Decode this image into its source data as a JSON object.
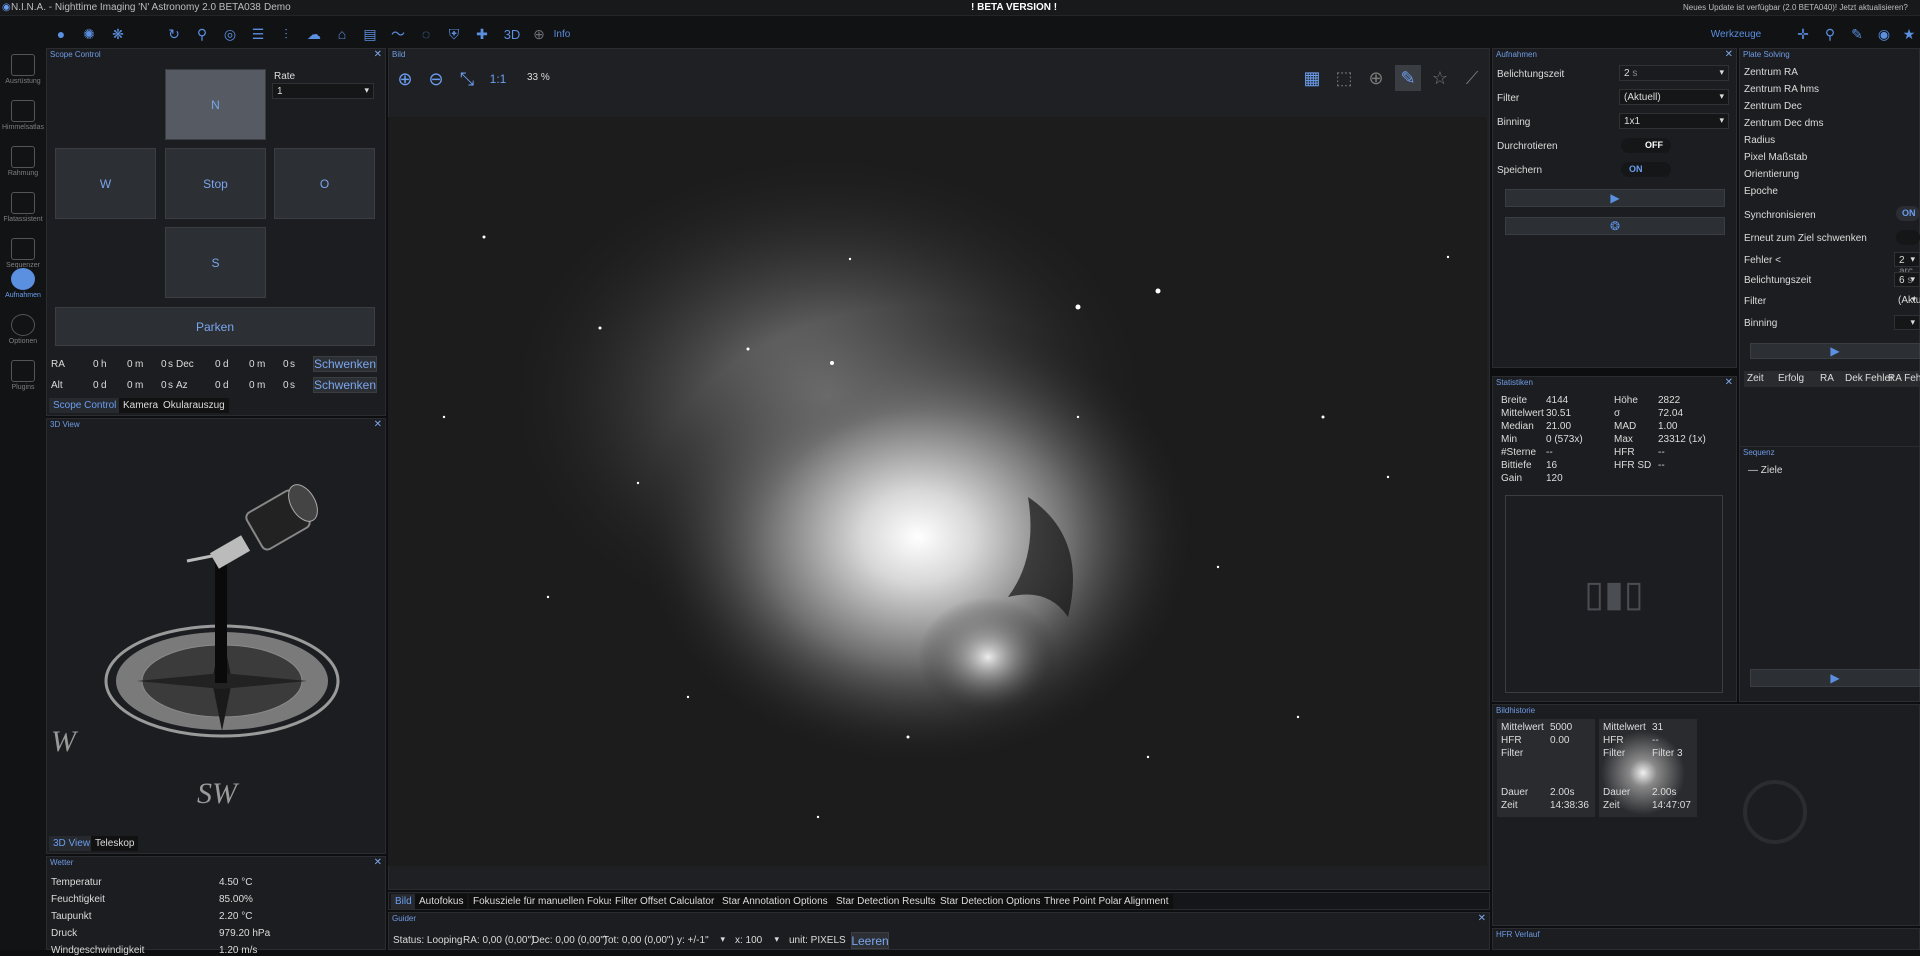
{
  "titlebar": {
    "app_title": "N.I.N.A. - Nighttime Imaging 'N' Astronomy 2.0 BETA038",
    "profile": "Demo",
    "beta_notice": "! BETA VERSION !",
    "update_notice": "Neues Update ist verfügbar (2.0 BETA040)! Jetzt aktualisieren?"
  },
  "toolbar": {
    "btn_3d": "3D",
    "btn_info": "Info",
    "tools_label": "Werkzeuge",
    "icons": [
      "camera-icon",
      "filter-wheel-icon",
      "focuser-icon",
      "rotator-icon",
      "telescope-icon",
      "guider-icon",
      "weather-icon",
      "dome-icon",
      "flat-panel-icon",
      "switch-icon",
      "guide-graph-icon",
      "bulb-icon",
      "safety-icon",
      "plugin-icon"
    ]
  },
  "sidebar": {
    "items": [
      {
        "label": "Ausrüstung",
        "icon": "equipment-icon"
      },
      {
        "label": "Himmelsatlas",
        "icon": "sky-atlas-icon"
      },
      {
        "label": "Rahmung",
        "icon": "framing-icon"
      },
      {
        "label": "Flatassistent",
        "icon": "flat-wizard-icon"
      },
      {
        "label": "Sequenzer",
        "icon": "sequencer-icon"
      },
      {
        "label": "Aufnahmen",
        "icon": "imaging-icon"
      },
      {
        "label": "Optionen",
        "icon": "options-icon"
      },
      {
        "label": "Plugins",
        "icon": "plugins-icon"
      }
    ]
  },
  "scope": {
    "title": "Scope Control",
    "rate_label": "Rate",
    "rate_value": "1",
    "north": "N",
    "west": "W",
    "stop": "Stop",
    "east": "O",
    "south": "S",
    "park": "Parken",
    "ra_label": "RA",
    "dec_label": "Dec",
    "alt_label": "Alt",
    "az_label": "Az",
    "ra_h": "0",
    "h": "h",
    "ra_m": "0",
    "m": "m",
    "ra_s": "0",
    "s": "s",
    "dec_d": "0",
    "d": "d",
    "dec_m": "0",
    "dec_s": "0",
    "alt_d": "0",
    "alt_m": "0",
    "alt_s": "0",
    "az_d": "0",
    "az_m": "0",
    "az_s": "0",
    "slew": "Schwenken",
    "tabs": [
      "Scope Control",
      "Kamera",
      "Okularauszug"
    ]
  },
  "view3d": {
    "title": "3D View",
    "compass_w": "W",
    "compass_sw": "SW",
    "tabs": [
      "3D View",
      "Teleskop"
    ]
  },
  "weather": {
    "title": "Wetter",
    "rows": [
      {
        "label": "Temperatur",
        "value": "4.50 °C"
      },
      {
        "label": "Feuchtigkeit",
        "value": "85.00%"
      },
      {
        "label": "Taupunkt",
        "value": "2.20 °C"
      },
      {
        "label": "Druck",
        "value": "979.20 hPa"
      },
      {
        "label": "Windgeschwindigkeit",
        "value": "1.20 m/s"
      }
    ]
  },
  "image": {
    "title": "Bild",
    "zoom_label": "1:1",
    "zoom_percent": "33 %"
  },
  "bottom_tabs": [
    "Bild",
    "Autofokus",
    "Fokusziele für manuellen Fokus",
    "Filter Offset Calculator",
    "Star Annotation Options",
    "Star Detection Results",
    "Star Detection Options",
    "Three Point Polar Alignment"
  ],
  "guider": {
    "title": "Guider",
    "status": "Status: Looping",
    "ra": "RA: 0,00 (0,00\")",
    "dec": "Dec: 0,00 (0,00\")",
    "tot": "Tot: 0,00 (0,00\")",
    "y_select": "y: +/-1\"",
    "x_select": "x: 100",
    "unit_select": "unit: PIXELS",
    "clear": "Leeren"
  },
  "capture": {
    "title": "Aufnahmen",
    "exposure_label": "Belichtungszeit",
    "exposure_value": "2",
    "exposure_unit": "s",
    "filter_label": "Filter",
    "filter_value": "(Aktuell)",
    "binning_label": "Binning",
    "binning_value": "1x1",
    "loop_label": "Durchrotieren",
    "loop_value": "OFF",
    "save_label": "Speichern",
    "save_value": "ON"
  },
  "stats": {
    "title": "Statistiken",
    "left": [
      {
        "label": "Breite",
        "value": "4144"
      },
      {
        "label": "Mittelwert",
        "value": "30.51"
      },
      {
        "label": "Median",
        "value": "21.00"
      },
      {
        "label": "Min",
        "value": "0 (573x)"
      },
      {
        "label": "#Sterne",
        "value": "--"
      },
      {
        "label": "Bittiefe",
        "value": "16"
      },
      {
        "label": "Gain",
        "value": "120"
      }
    ],
    "right": [
      {
        "label": "Höhe",
        "value": "2822"
      },
      {
        "label": "σ",
        "value": "72.04"
      },
      {
        "label": "MAD",
        "value": "1.00"
      },
      {
        "label": "Max",
        "value": "23312 (1x)"
      },
      {
        "label": "HFR",
        "value": "--"
      },
      {
        "label": "HFR SD",
        "value": "--"
      }
    ]
  },
  "history": {
    "title": "Bildhistorie",
    "cards": [
      {
        "mean_label": "Mittelwert",
        "mean": "5000",
        "hfr_label": "HFR",
        "hfr": "0.00",
        "filter_label": "Filter",
        "filter": "",
        "dur_label": "Dauer",
        "dur": "2.00s",
        "time_label": "Zeit",
        "time": "14:38:36"
      },
      {
        "mean_label": "Mittelwert",
        "mean": "31",
        "hfr_label": "HFR",
        "hfr": "--",
        "filter_label": "Filter",
        "filter": "Filter 3",
        "dur_label": "Dauer",
        "dur": "2.00s",
        "time_label": "Zeit",
        "time": "14:47:07"
      }
    ]
  },
  "hfr": {
    "title": "HFR Verlauf"
  },
  "plate": {
    "title": "Plate Solving",
    "rows": [
      "Zentrum RA",
      "Zentrum RA hms",
      "Zentrum Dec",
      "Zentrum Dec dms",
      "Radius",
      "Pixel Maßstab",
      "Orientierung",
      "Epoche"
    ],
    "sync_label": "Synchronisieren",
    "sync_value": "ON",
    "reslew_label": "Erneut zum Ziel schwenken",
    "error_label": "Fehler <",
    "error_value": "2",
    "error_unit": "arc",
    "exposure_label": "Belichtungszeit",
    "exposure_value": "6",
    "exposure_unit": "s",
    "filter_label": "Filter",
    "filter_value": "(Aktu",
    "binning_label": "Binning",
    "table_headers": [
      "Zeit",
      "Erfolg",
      "RA",
      "Dek",
      "Fehler",
      "RA Feh"
    ]
  },
  "sequence": {
    "title": "Sequenz",
    "item": "Ziele"
  }
}
